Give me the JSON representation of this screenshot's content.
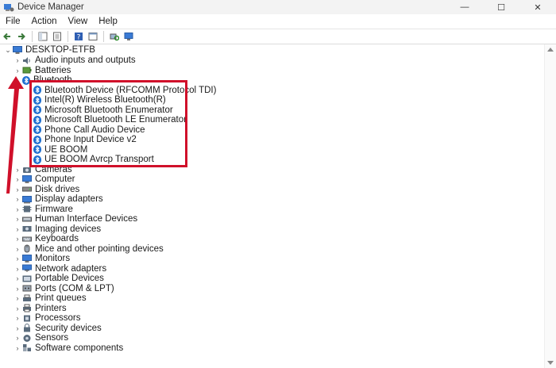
{
  "window": {
    "title": "Device Manager",
    "controls": {
      "minimize": "—",
      "maximize": "☐",
      "close": "✕"
    }
  },
  "menu": [
    "File",
    "Action",
    "View",
    "Help"
  ],
  "tree": {
    "root": "DESKTOP-ETFB",
    "categories_before": [
      {
        "label": "Audio inputs and outputs",
        "icon": "speaker-icon"
      },
      {
        "label": "Batteries",
        "icon": "battery-icon"
      }
    ],
    "expanded": {
      "label": "Bluetooth",
      "icon": "bluetooth-icon",
      "children": [
        "Bluetooth Device (RFCOMM Protocol TDI)",
        "Intel(R) Wireless Bluetooth(R)",
        "Microsoft Bluetooth Enumerator",
        "Microsoft Bluetooth LE Enumerator",
        "Phone Call Audio Device",
        "Phone Input Device v2",
        "UE BOOM",
        "UE BOOM Avrcp Transport"
      ]
    },
    "categories_after": [
      {
        "label": "Cameras",
        "icon": "camera-icon"
      },
      {
        "label": "Computer",
        "icon": "computer-icon"
      },
      {
        "label": "Disk drives",
        "icon": "disk-icon"
      },
      {
        "label": "Display adapters",
        "icon": "display-adapter-icon"
      },
      {
        "label": "Firmware",
        "icon": "firmware-icon"
      },
      {
        "label": "Human Interface Devices",
        "icon": "hid-icon"
      },
      {
        "label": "Imaging devices",
        "icon": "imaging-icon"
      },
      {
        "label": "Keyboards",
        "icon": "keyboard-icon"
      },
      {
        "label": "Mice and other pointing devices",
        "icon": "mouse-icon"
      },
      {
        "label": "Monitors",
        "icon": "monitor-icon"
      },
      {
        "label": "Network adapters",
        "icon": "network-icon"
      },
      {
        "label": "Portable Devices",
        "icon": "portable-device-icon"
      },
      {
        "label": "Ports (COM & LPT)",
        "icon": "port-icon"
      },
      {
        "label": "Print queues",
        "icon": "print-queue-icon"
      },
      {
        "label": "Printers",
        "icon": "printer-icon"
      },
      {
        "label": "Processors",
        "icon": "processor-icon"
      },
      {
        "label": "Security devices",
        "icon": "security-icon"
      },
      {
        "label": "Sensors",
        "icon": "sensor-icon"
      },
      {
        "label": "Software components",
        "icon": "software-component-icon"
      }
    ]
  },
  "colors": {
    "highlight": "#d0102a",
    "bluetooth": "#1e6fd0",
    "icon_grey": "#5a6b7c"
  }
}
